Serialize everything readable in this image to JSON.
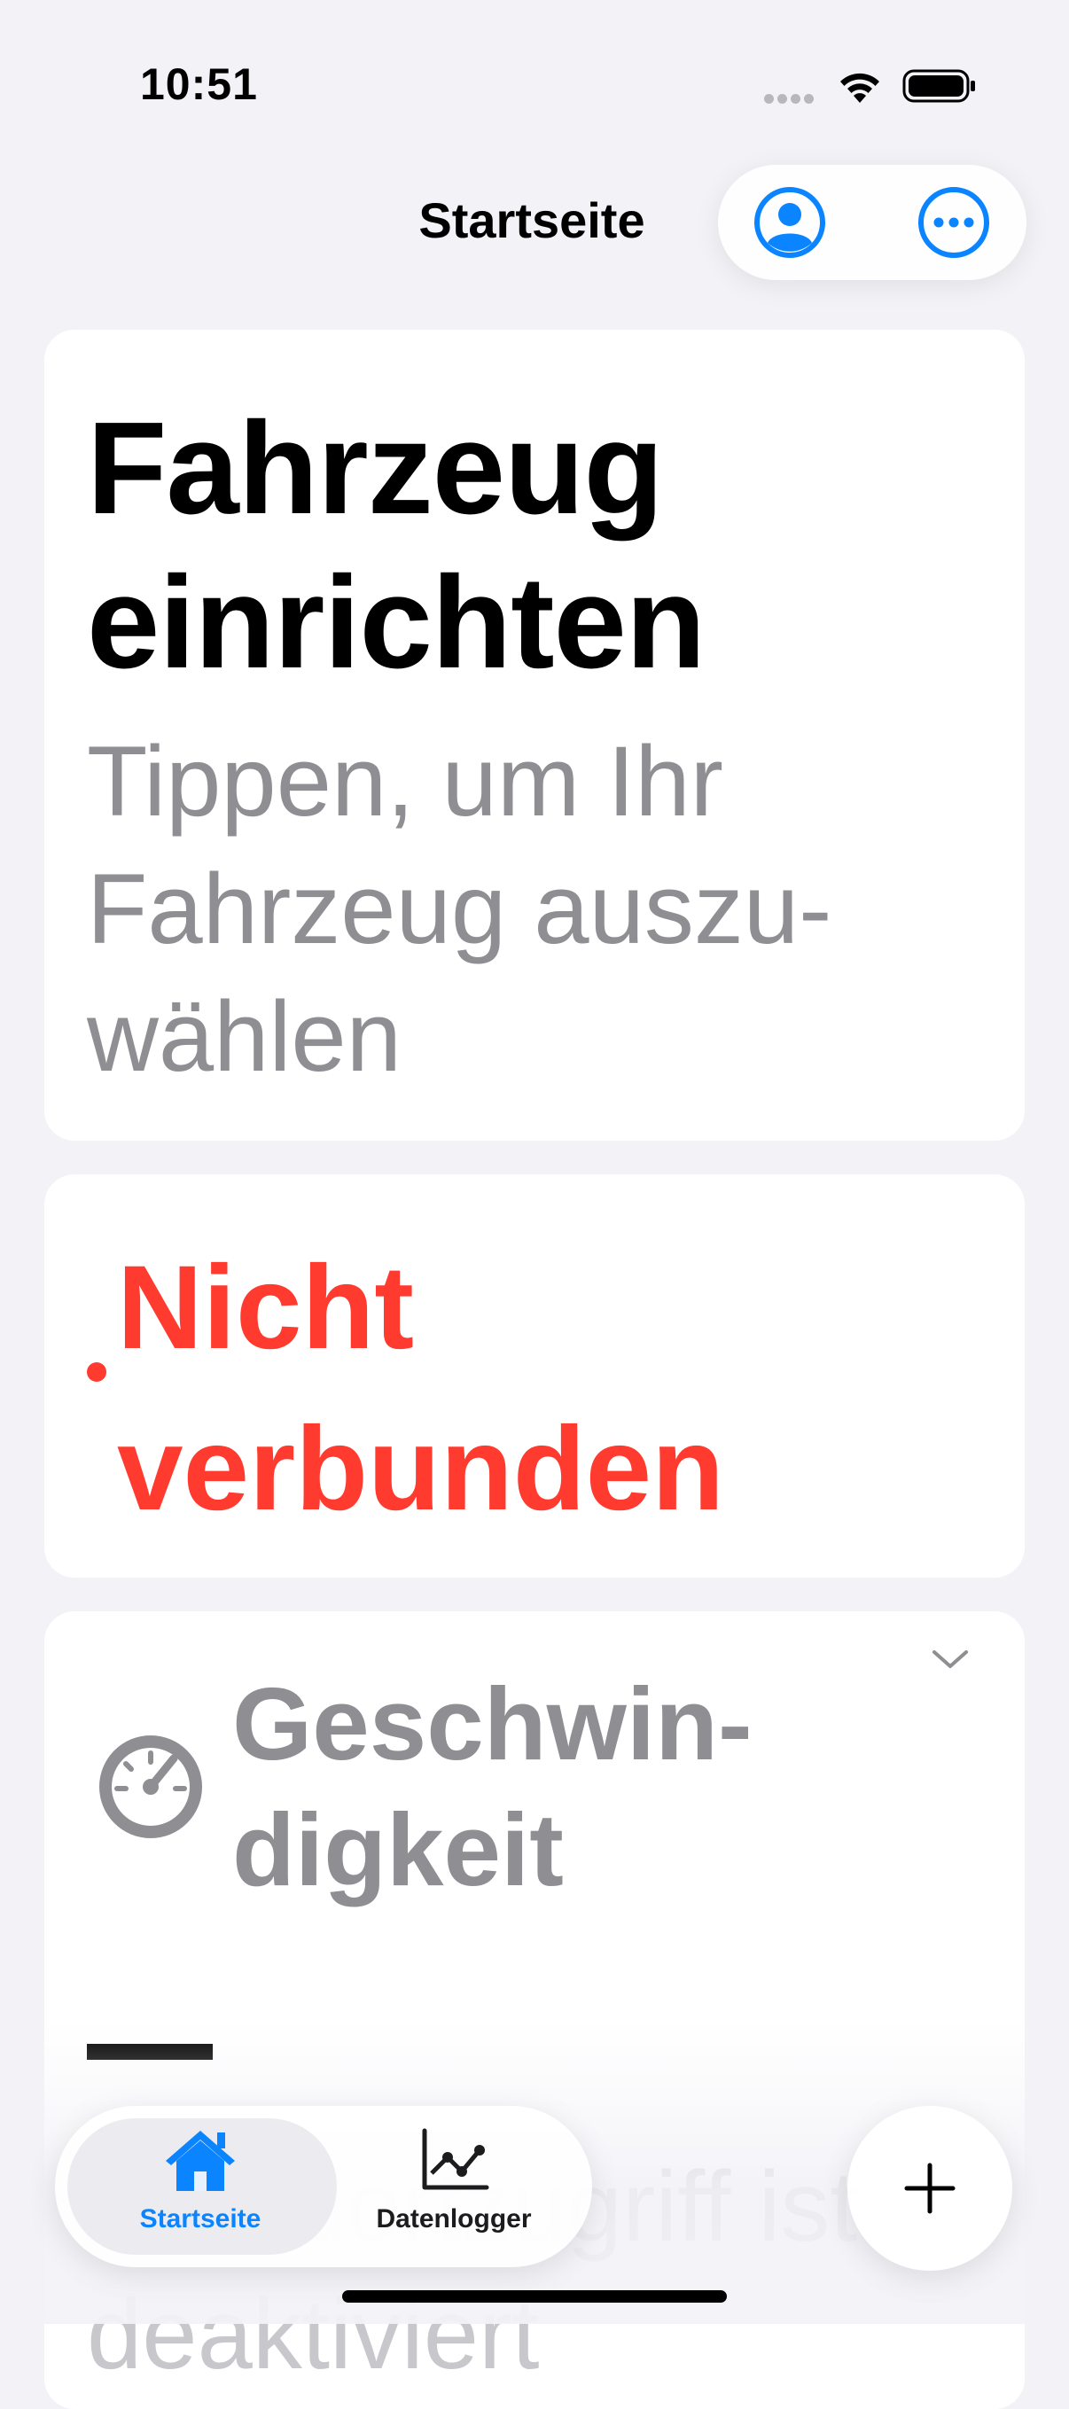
{
  "status_bar": {
    "time": "10:51"
  },
  "nav": {
    "title": "Startseite"
  },
  "vehicle_card": {
    "title": "Fahrzeug einrichten",
    "subtitle_lines": [
      "Tippen, um Ihr",
      "Fahrzeug auszu-",
      "wählen"
    ]
  },
  "connection_card": {
    "status_lines": [
      "Nicht",
      "verbunden"
    ],
    "status_color": "#ff3b30"
  },
  "speed_card": {
    "title_lines": [
      "Geschwin-",
      "digkeit"
    ],
    "value": "—",
    "hint": "Standortzugriff ist deaktiviert"
  },
  "tabbar": {
    "tabs": [
      {
        "label": "Startseite",
        "icon": "house-icon",
        "selected": true
      },
      {
        "label": "Datenlogger",
        "icon": "line-chart-icon",
        "selected": false
      }
    ]
  },
  "colors": {
    "accent": "#0a84ff",
    "secondary_text": "#8e8e93",
    "background": "#f2f2f7"
  }
}
